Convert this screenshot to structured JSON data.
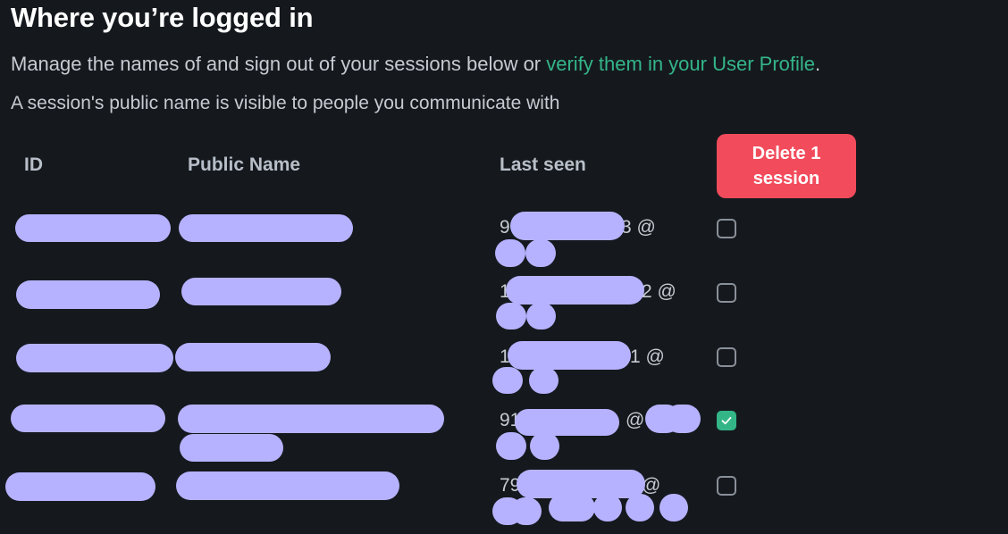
{
  "header": {
    "title": "Where you’re logged in",
    "description_prefix": "Manage the names of and sign out of your sessions below or ",
    "description_link": "verify them in your User Profile",
    "description_suffix": ".",
    "subdescription": "A session's public name is visible to people you communicate with"
  },
  "table": {
    "columns": [
      "ID",
      "Public Name",
      "Last seen"
    ],
    "delete_button_label": "Delete 1 session",
    "rows": [
      {
        "last_seen_start": "9",
        "last_seen_end": "3 @",
        "checked": false
      },
      {
        "last_seen_start": "1",
        "last_seen_end": "2 @",
        "checked": false
      },
      {
        "last_seen_start": "1",
        "last_seen_end": "1 @",
        "checked": false
      },
      {
        "last_seen_start": "91",
        "last_seen_end": "@",
        "checked": true
      },
      {
        "last_seen_start": "79",
        "last_seen_end": "@",
        "checked": false
      }
    ]
  },
  "colors": {
    "background": "#15191e",
    "accent": "#34b588",
    "danger": "#f24b5b",
    "redaction": "#b6b2ff"
  },
  "icons": {
    "check": "check-icon"
  }
}
